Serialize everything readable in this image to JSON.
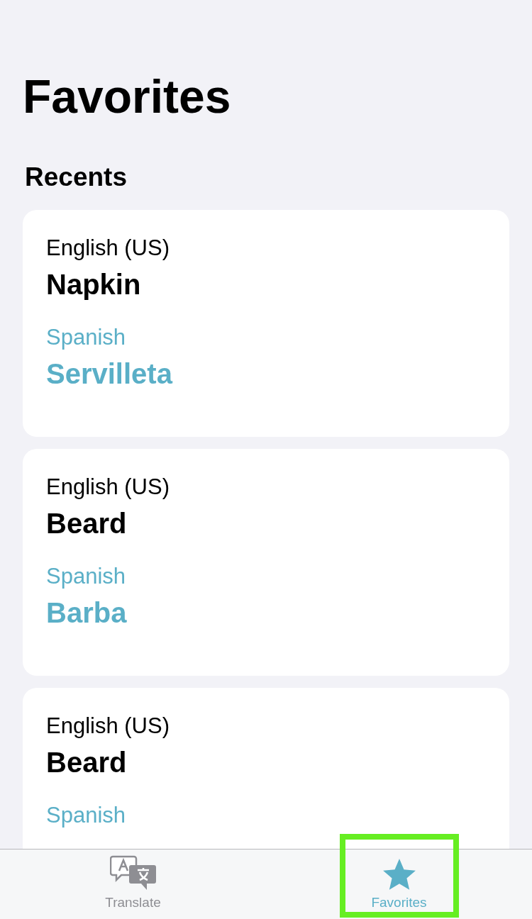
{
  "title": "Favorites",
  "section": "Recents",
  "cards": [
    {
      "source_language": "English (US)",
      "source_text": "Napkin",
      "target_language": "Spanish",
      "target_text": "Servilleta"
    },
    {
      "source_language": "English (US)",
      "source_text": "Beard",
      "target_language": "Spanish",
      "target_text": "Barba"
    },
    {
      "source_language": "English (US)",
      "source_text": "Beard",
      "target_language": "Spanish"
    }
  ],
  "tabs": [
    {
      "kind": "translate",
      "label": "Translate",
      "selected": false,
      "highlighted": false
    },
    {
      "kind": "favorites",
      "label": "Favorites",
      "selected": true,
      "highlighted": true
    }
  ]
}
